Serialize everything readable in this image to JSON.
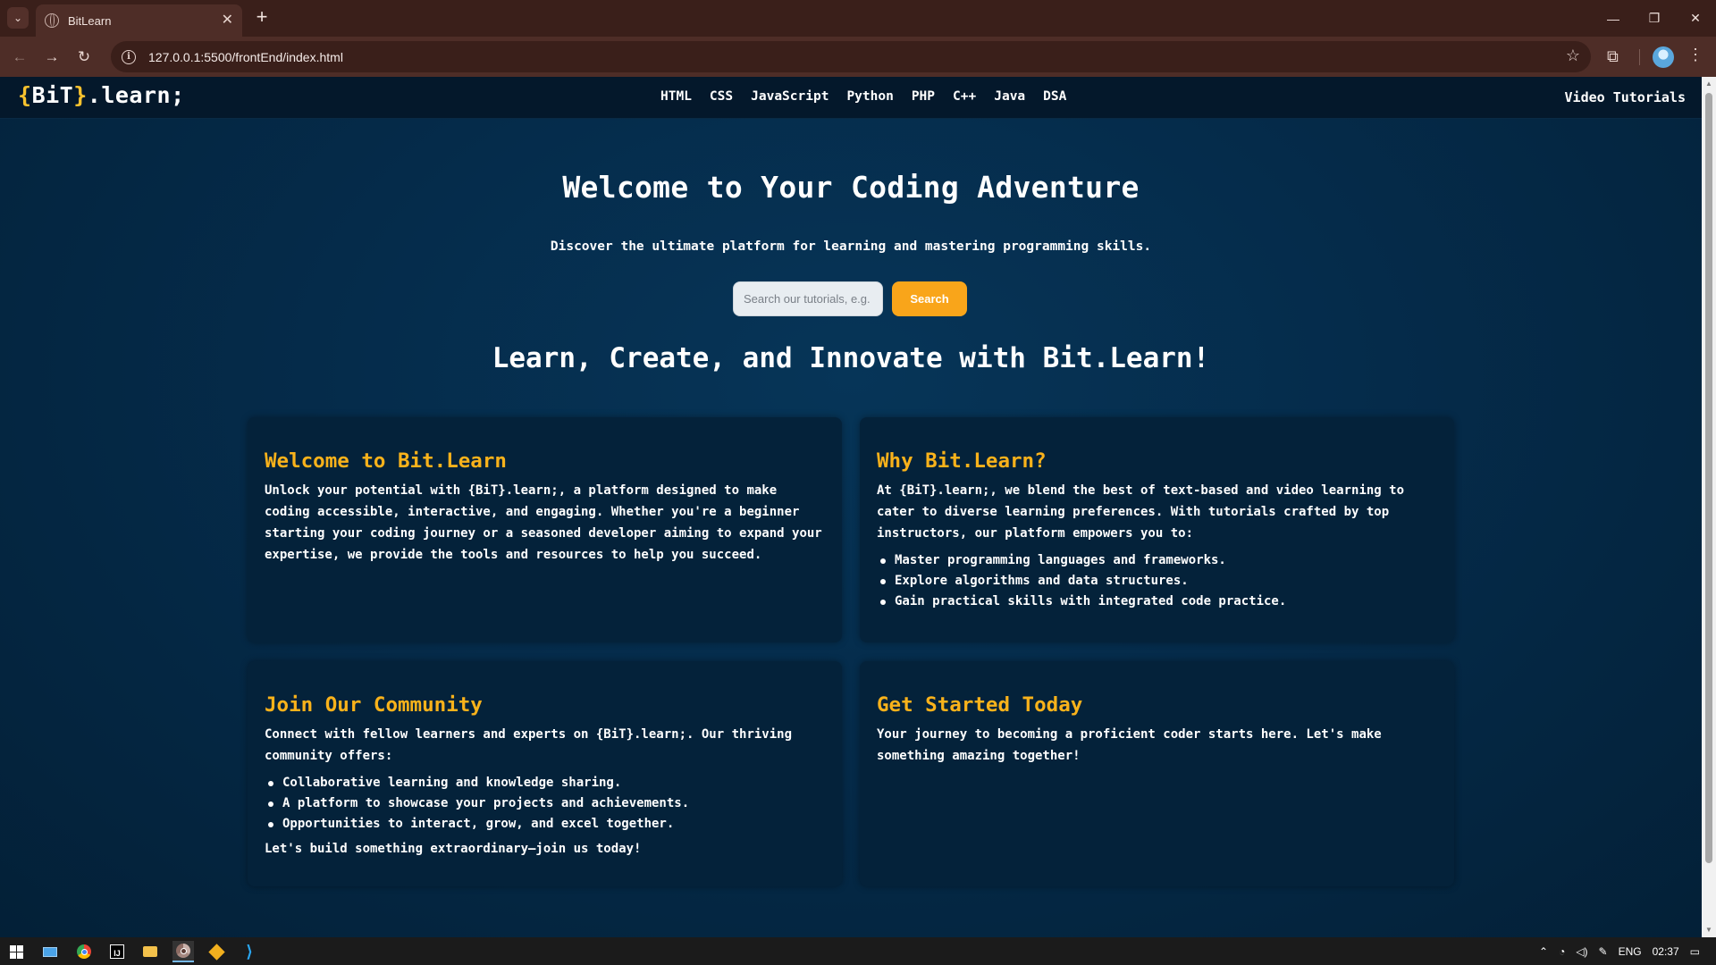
{
  "browser": {
    "tab_title": "BitLearn",
    "url": "127.0.0.1:5500/frontEnd/index.html",
    "new_tab_symbol": "+",
    "close_symbol": "✕"
  },
  "site": {
    "logo": {
      "brace_open": "{",
      "bit": "BiT",
      "brace_close": "}",
      "rest": ".learn;"
    },
    "nav_links": [
      "HTML",
      "CSS",
      "JavaScript",
      "Python",
      "PHP",
      "C++",
      "Java",
      "DSA"
    ],
    "video_link": "Video Tutorials"
  },
  "hero": {
    "title": "Welcome to Your Coding Adventure",
    "subtitle": "Discover the ultimate platform for learning and mastering programming skills.",
    "search_placeholder": "Search our tutorials, e.g. HTML",
    "search_button": "Search"
  },
  "section_title": "Learn, Create, and Innovate with Bit.Learn!",
  "cards": [
    {
      "title": "Welcome to Bit.Learn",
      "body": "Unlock your potential with {BiT}.learn;, a platform designed to make coding accessible, interactive, and engaging. Whether you're a beginner starting your coding journey or a seasoned developer aiming to expand your expertise, we provide the tools and resources to help you succeed."
    },
    {
      "title": "Why Bit.Learn?",
      "body": "At {BiT}.learn;, we blend the best of text-based and video learning to cater to diverse learning preferences. With tutorials crafted by top instructors, our platform empowers you to:",
      "items": [
        "Master programming languages and frameworks.",
        "Explore algorithms and data structures.",
        "Gain practical skills with integrated code practice."
      ]
    },
    {
      "title": "Join Our Community",
      "body": "Connect with fellow learners and experts on {BiT}.learn;. Our thriving community offers:",
      "items": [
        "Collaborative learning and knowledge sharing.",
        "A platform to showcase your projects and achievements.",
        "Opportunities to interact, grow, and excel together."
      ],
      "closing": "Let's build something extraordinary—join us today!"
    },
    {
      "title": "Get Started Today",
      "body": "Your journey to becoming a proficient coder starts here. Let's make something amazing together!"
    }
  ],
  "taskbar": {
    "language": "ENG",
    "time": "02:37"
  },
  "colors": {
    "accent": "#f9a51a",
    "heading_gold": "#f9b21b",
    "page_bg": "#052b4a",
    "nav_bg": "#04182b",
    "card_bg": "#04223a"
  }
}
